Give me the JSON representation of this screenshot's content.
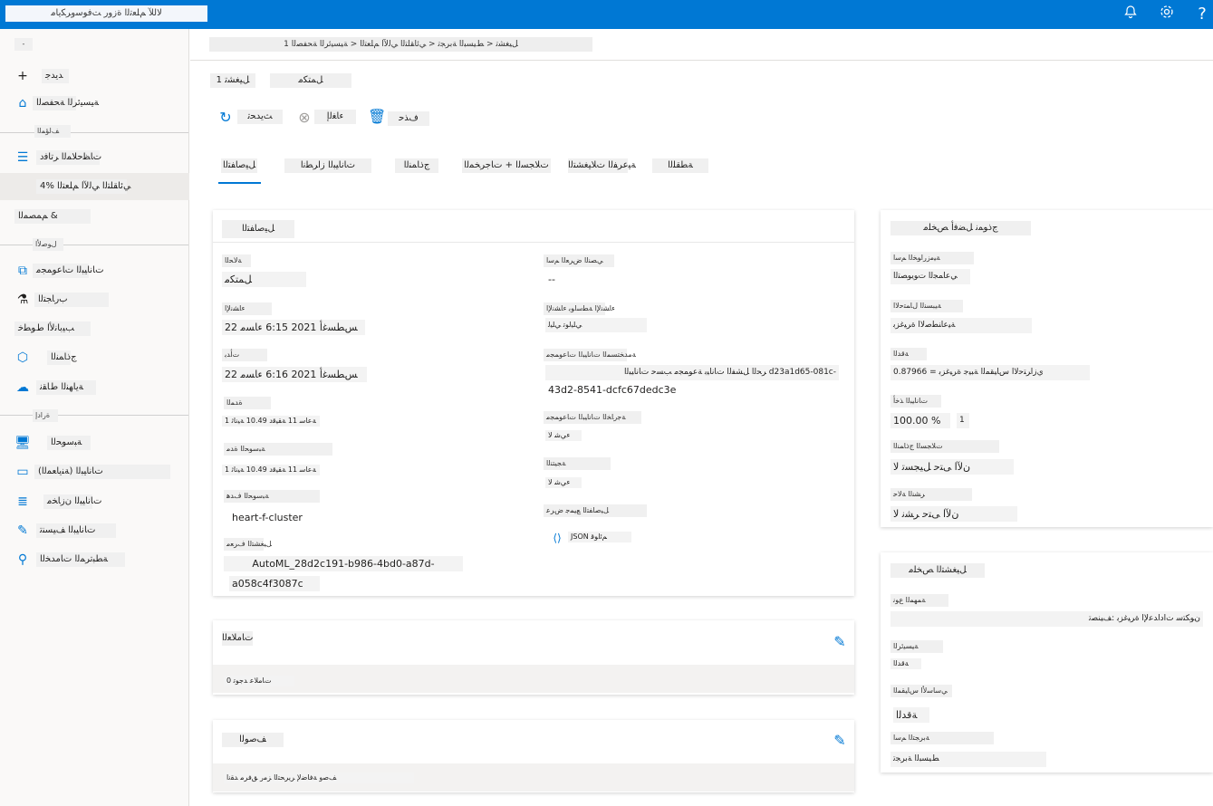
{
  "topbar": {
    "brand": "ﻻﻟﻶ ﻢﻠﻌﺗﻟﺍ ﺓﺯﻭﺭ ﺖﻓﻮﺳﻭﺮﻜﻳﺎﻣ",
    "icons": [
      "bell-icon",
      "gear-icon",
      "help-icon"
    ],
    "accent": "#0078d4"
  },
  "sidebar": {
    "collapse": "-",
    "items": [
      {
        "label": "ﺪﻳﺪﺟ",
        "icon": "plus-icon"
      },
      {
        "label": "ﺔﻴﺴﻴﺋﺮﻟﺍ ﺔﺤﻔﺼﻟﺍ",
        "icon": "home-icon"
      },
      {
        "label": "ﻒﻟﺆﻤﻟﺍ",
        "icon": ""
      },
      {
        "label": "ﺕﺎﻈﺣﻼﻤﻟﺍ ﺮﺗﺎﻓﺩ",
        "icon": "notebook-icon"
      },
      {
        "label": "ﻲﺋﺎﻘﻠﺘﻟﺍ ﻲﻟﻵﺍ ﻢﻠﻌﺘﻟﺍ %4",
        "icon": ""
      },
      {
        "label": "ﻢﻤﺼﻤﻟﺍ &",
        "icon": ""
      },
      {
        "label": "ﻝﻮﺻﻷﺍ",
        "icon": ""
      },
      {
        "label": "ﺕﺎﻧﺎﻴﺒﻟﺍ ﺕﺎﻋﻮﻤﺠﻣ",
        "icon": "datasets-icon"
      },
      {
        "label": "ﺏﺭﺎﺠﺘﻟﺍ",
        "icon": "flask-icon"
      },
      {
        "label": "ﺐﻴﺑﺎﻧﻷﺍ ﻁﻮﻄﺧ",
        "icon": "pipeline-icon"
      },
      {
        "label": "ﺝﺫﺎﻤﻨﻟﺍ",
        "icon": "cube-icon"
      },
      {
        "label": "ﺔﻳﺎﻬﻨﻟﺍ ﻁﺎﻘﻧ",
        "icon": "endpoint-icon"
      },
      {
        "label": "ﺓﺭﺍﺩﺇ",
        "icon": ""
      },
      {
        "label": "ﺔﺒﺳﻮﺤﻟﺍ",
        "icon": "compute-icon"
      },
      {
        "label": "ﺕﺎﻧﺎﻴﺒﻟﺍ (ﺔﻨﻳﺎﻌﻤﻟﺍ)",
        "icon": "labeling-icon"
      },
      {
        "label": "ﺕﺎﻧﺎﻴﺒﻟﺍ ﻥﺯﺎﺨﻣ",
        "icon": "datastore-icon"
      },
      {
        "label": "ﺕﺎﻧﺎﻴﺒﻟﺍ ﻒﻴﺴﻨﺗ",
        "icon": "edit-icon"
      },
      {
        "label": "ﺔﻄﺒﺗﺮﻤﻟﺍ ﺕﺎﻣﺪﺨﻟﺍ",
        "icon": "linked-icon"
      }
    ]
  },
  "breadcrumb": "1 ﻞﻴﻐﺸﺗ < ﻂﻴﺴﺒﻟﺍ ﺔﺑﺮﺠﺗ < ﻲﺋﺎﻘﻠﺘﻟﺍ ﻲﻟﻵﺍ ﻢﻠﻌﺘﻟﺍ < ﺔﻴﺴﻴﺋﺮﻟﺍ ﺔﺤﻔﺼﻟﺍ",
  "header": {
    "run_name": "1 ﻞﻴﻐﺸﺗ",
    "status": "ﻞﻤﺘﻜﻣ"
  },
  "toolbar": {
    "refresh": "ﺚﻳﺪﺤﺗ",
    "cancel": "ﺀﺎﻐﻟﺇ",
    "delete": "ﻑﺬﺣ"
  },
  "tabs": [
    "ﻞﻴﺻﺎﻔﺘﻟﺍ",
    "ﺕﺎﻧﺎﻴﺒﻟﺍ ﺯﺍﺮﻄﻧﺍ",
    "ﺝﺫﺎﻤﻨﻟﺍ",
    "ﺕﻼﺠﺴﻟﺍ + ﺕﺎﺟﺮﺨﻤﻟﺍ",
    "ﺔﻴﻋﺮﻔﻟﺍ ﺕﻼﻴﻐﺸﺘﻟﺍ",
    "ﺔﻄﻘﻠﻟﺍ"
  ],
  "details": {
    "title": "ﻞﻴﺻﺎﻔﺘﻟﺍ",
    "left": [
      {
        "label": "ﺔﻟﺎﺤﻟﺍ",
        "value": "ﻞﻤﺘﻜﻣ"
      },
      {
        "label": "ﺀﺎﺸﻧﻹﺍ",
        "value": "22 ﺲﻄﺴﻏﺃ 2021 6:15 ﺀﺎﺴﻣ"
      },
      {
        "label": "ﺕﺃﺪﺑ",
        "value": "22 ﺲﻄﺴﻏﺃ 2021 6:16 ﺀﺎﺴﻣ"
      },
      {
        "label": "ﺓﺪﻤﻟﺍ",
        "value": "1 ﺔﻋﺎﺳ 11 ﺔﻘﻴﻗﺩ 10.49 ﺔﻴﻧﺎﺛ"
      },
      {
        "label": "ﺔﺒﺳﻮﺤﻟﺍ ﺓﺪﻣ",
        "value": "1 ﺔﻋﺎﺳ 11 ﺔﻘﻴﻗﺩ 10.49 ﺔﻴﻧﺎﺛ"
      },
      {
        "label": "ﺔﺒﺳﻮﺤﻟﺍ ﻑﺪﻫ",
        "value": "heart-f-cluster"
      },
      {
        "label": "ﻞﻴﻐﺸﺘﻟﺍ ﻑﺮﻌﻣ",
        "value1": "AutoML_28d2c191-b986-4bd0-a87d-",
        "value2": "a058c4f3087c"
      }
    ],
    "right": [
      {
        "label": "ﻲﺼﻨﻟﺍ ﺽﺮﻌﻟﺍ ﻢﺳﺍ",
        "value": "--"
      },
      {
        "label": "ﺀﺎﺸﻧﻹﺍ ﺔﻄﺳﺍﻮﺑ ﺀﺎﺸﻧﻹﺍ",
        "value": "ﻲﻠﻴﻟﻮﺗ ﻲﻠﻴﻟ"
      },
      {
        "label": "ﺔﻣﺪﺨﺘﺴﻤﻟﺍ ﺕﺎﻧﺎﻴﺒﻟﺍ ﺕﺎﻋﻮﻤﺠﻣ",
        "value1": "-d23a1d65-081c ﺮﺤﻟﺍ ﻞﺸﻔﻟﺍ ﺕﺎﻧﺎﻴﺑ ﺔﻋﻮﻤﺠﻣ ﺐﺴﺣ ﺕﺎﻧﺎﻴﺒﻟﺍ",
        "value2": "43d2-8541-dcfc67dedc3e"
      },
      {
        "label": "ﺔﺟﺭﺎﺨﻟﺍ ﺕﺎﻧﺎﻴﺒﻟﺍ ﺕﺎﻋﻮﻤﺠﻣ",
        "value": "ﺀﻲﺷ ﻻ"
      },
      {
        "label": "ﺔﺠﻴﺘﻨﻟﺍ",
        "value": "ﺀﻲﺷ ﻻ"
      },
      {
        "label": "ﻞﻴﺻﺎﻔﺘﻟﺍ ﻊﻴﻤﺟ ﺽﺮﻋ",
        "value": "JSON ﻢﺋﺍﻮﻗ"
      }
    ]
  },
  "best_model": {
    "title": "ﺝﺫﻮﻤﻧ ﻞﻀﻓﺃ ﺺﺨﻠﻣ",
    "rows": [
      {
        "label": "ﺔﻴﻣﺯﺭﺍﻮﺨﻟﺍ ﻢﺳﺍ",
        "value": "ﻲﻋﺎﻤﺠﻟﺍ ﺕﻮﻳﻮﺼﺘﻟﺍ"
      },
      {
        "label": "ﺔﻴﺒﺴﻨﻟﺍ ﻝﺎﻤﺘﺣﻻﺍ",
        "value": "ﺔﻴﻋﺎﻨﻄﺻﻻﺍ ﺓﺮﻴﻏﺰﺑ"
      },
      {
        "label": "ﺔﻗﺪﻟﺍ",
        "value": "0.87966 = ﻱﺯﺍﺮﺘﺣﻻﺍ ﺱﺎﻴﻘﻤﻟﺍ ﺔﺒﻴﺟ ﺓﺮﻴﻏﺰﺑ"
      },
      {
        "label": "ﺕﺎﻧﺎﻴﺒﻟﺍ ﺬﺧﺃ",
        "value": "100.00 %",
        "badge": "1"
      },
      {
        "label": "ﺕﻼﺠﺴﻟﺍ ﺝﺫﺎﻤﻨﻟﺍ",
        "value": "ﻥﻵﺍ ﻰﺘﺣ ﻞﻴﺠﺴﺗ ﻻ"
      },
      {
        "label": "ﺮﺸﻨﻟﺍ ﺔﻟﺎﺣ",
        "value": "ﻥﻵﺍ ﻰﺘﺣ ﺮﺸﻧ ﻻ"
      }
    ]
  },
  "run_summary": {
    "title": "ﻞﻴﻐﺸﺘﻟﺍ ﺺﺨﻠﻣ",
    "rows": [
      {
        "label": "ﺔﻤﻬﻤﻟﺍ ﻉﻮﻧ",
        "value": "ﻥﻮﻜﺘﺳ ﺕﺍﺩﺍﺪﻋﻹﺍ ﺓﺮﻴﻏﺰﺑ :ﻒﻴﻨﺼﺗ"
      },
      {
        "label": "ﺔﻴﺴﻴﺋﺮﻟﺍ",
        "value": "ﺔﻗﺪﻟﺍ"
      },
      {
        "label": "ﻲﺳﺎﺳﻷﺍ ﺱﺎﻴﻘﻤﻟﺍ",
        "value": "ﺔﻗﺪﻟﺍ"
      },
      {
        "label": "ﺔﺑﺮﺠﺘﻟﺍ ﻢﺳﺍ",
        "value": "ﻂﻴﺴﺒﻟﺍ ﺔﺑﺮﺠﺗ"
      }
    ]
  },
  "tags": {
    "title": "ﺕﺎﻣﻼﻌﻟﺍ",
    "empty": "0 ﺕﺎﻣﻼﻋ ﺪﺟﻮﺗ"
  },
  "description": {
    "title": "ﻒﺻﻮﻟﺍ",
    "empty": "ﻒﺻﻭ ﺔﻓﺎﺿﻹ ﺮﻳﺮﺤﺘﻟﺍ ﺰﻣﺭ ﻖﻓﺮﻣ ﺪﻘﻧﺍ"
  }
}
